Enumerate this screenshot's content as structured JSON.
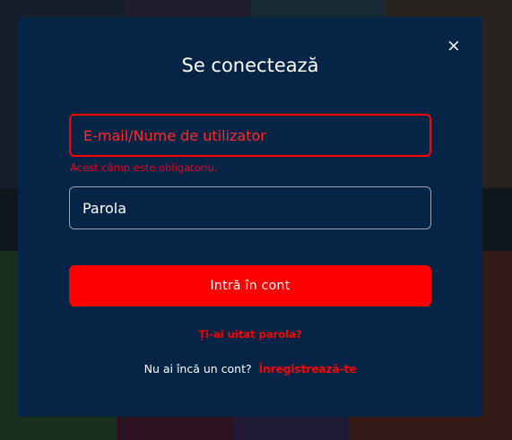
{
  "background": {
    "tile_colors": [
      "#8a1a1a",
      "#1f4a7a",
      "#3b2a55",
      "#b0621e",
      "#2e6b3a",
      "#6d1d4d",
      "#c9a227",
      "#1a3a2a"
    ]
  },
  "modal": {
    "title": "Se conectează",
    "close_icon": "×",
    "email": {
      "placeholder": "E-mail/Nume de utilizator",
      "value": "",
      "error": "Acest câmp este obligatoriu."
    },
    "password": {
      "placeholder": "Parola",
      "value": ""
    },
    "submit_label": "Intră în cont",
    "forgot_password": "Ți-ai uitat parola?",
    "register_prompt": "Nu ai încă un cont?",
    "register_link": "Înregistrează-te"
  },
  "colors": {
    "modal_bg": "#062445",
    "accent_red": "#ff0000",
    "text": "#ffffff"
  }
}
